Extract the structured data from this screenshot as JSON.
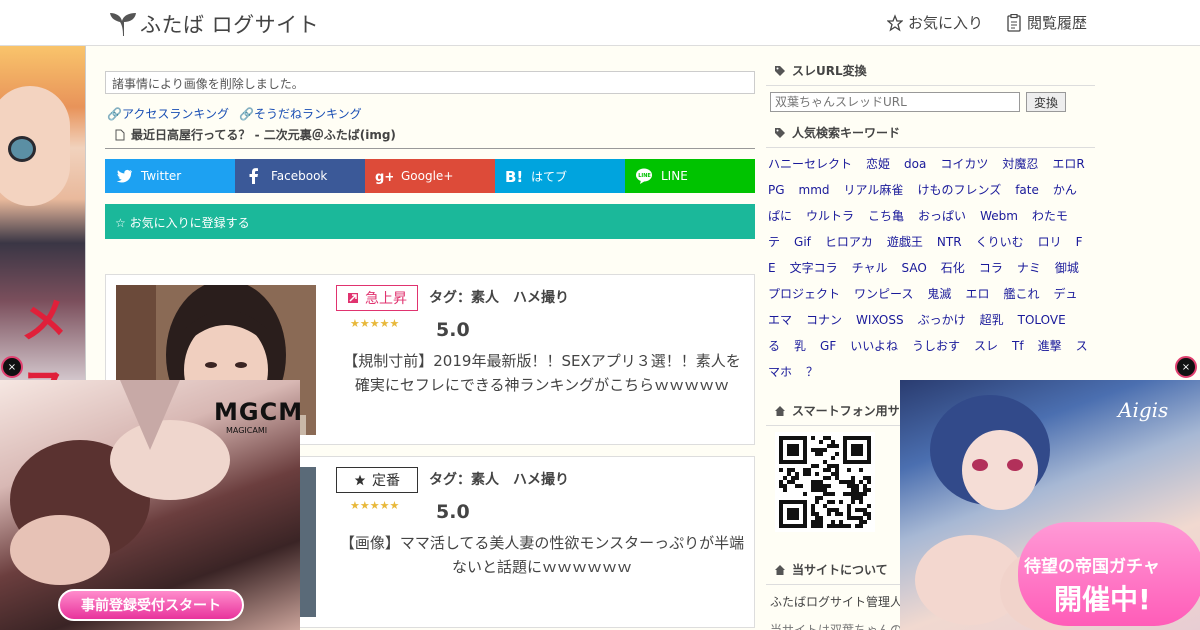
{
  "header": {
    "site_name": "ふたば ログサイト",
    "nav": [
      {
        "label": "お気に入り",
        "icon": "star-icon"
      },
      {
        "label": "閲覧履歴",
        "icon": "history-icon"
      }
    ]
  },
  "main": {
    "notice": "諸事情により画像を削除しました。",
    "ranking_links": [
      "アクセスランキング",
      "そうだねランキング"
    ],
    "source_line": "最近日高屋行ってる？ - 二次元裏＠ふたば(img)",
    "share_buttons": [
      {
        "label": "Twitter",
        "color": "#1da1f2",
        "icon": "twitter-icon"
      },
      {
        "label": "Facebook",
        "color": "#3b5998",
        "icon": "facebook-icon"
      },
      {
        "label": "Google+",
        "color": "#dd4b39",
        "icon": "google-plus-icon"
      },
      {
        "label": "はてブ",
        "color": "#00a4de",
        "icon": "hatena-icon"
      },
      {
        "label": "LINE",
        "color": "#00c300",
        "icon": "line-icon"
      }
    ],
    "favorite_label": "☆ お気に入りに登録する",
    "articles": [
      {
        "badge": "急上昇",
        "badge_icon": "rising-icon",
        "tags": "タグ：素人　ハメ撮り",
        "stars": "★★★★★",
        "score": "5.0",
        "title": "【規制寸前】2019年最新版！！SEXアプリ３選！！素人を確実にセフレにできる神ランキングがこちらｗｗｗｗｗ"
      },
      {
        "badge": "定番",
        "badge_icon": "star-icon",
        "tags": "タグ：素人　ハメ撮り",
        "stars": "★★★★★",
        "score": "5.0",
        "title": "【画像】ママ活してる美人妻の性欲モンスターっぷりが半端ないと話題にｗｗｗｗｗｗ"
      }
    ]
  },
  "sidebar": {
    "url_convert_heading": "スレURL変換",
    "url_input_placeholder": "双葉ちゃんスレッドURL",
    "url_button": "変換",
    "keyword_heading": "人気検索キーワード",
    "keywords": [
      "ハニーセレクト",
      "恋姫",
      "doa",
      "コイカツ",
      "対魔忍",
      "エロRPG",
      "mmd",
      "リアル麻雀",
      "けものフレンズ",
      "fate",
      "かんぱに",
      "ウルトラ",
      "こち亀",
      "おっぱい",
      "Webm",
      "わたモテ",
      "Gif",
      "ヒロアカ",
      "遊戯王",
      "NTR",
      "くりいむ",
      "ロリ",
      "FE",
      "文字コラ",
      "チャル",
      "SAO",
      "石化",
      "コラ",
      "ナミ",
      "御城プロジェクト",
      "ワンピース",
      "鬼滅",
      "エロ",
      "艦これ",
      "デュエマ",
      "コナン",
      "WIXOSS",
      "ぶっかけ",
      "超乳",
      "TOLOVEる",
      "乳",
      "GF",
      "いいよね",
      "うしおす",
      "スレ",
      "Tf",
      "進撃",
      "スマホ",
      "？"
    ],
    "smartphone_heading": "スマートフォン用サ",
    "about_heading": "当サイトについて",
    "about_text": "ふたばログサイト管理人",
    "about_text2": "当サイトは双葉ちゃんの"
  },
  "ads": {
    "left_logo": "MGCM",
    "left_logo_sub": "MAGICAMI",
    "left_cta": "事前登録受付スタート",
    "right_logo": "Aigis",
    "right_line1": "待望の帝国ガチャ",
    "right_line2": "開催中!",
    "close_label": "×"
  }
}
